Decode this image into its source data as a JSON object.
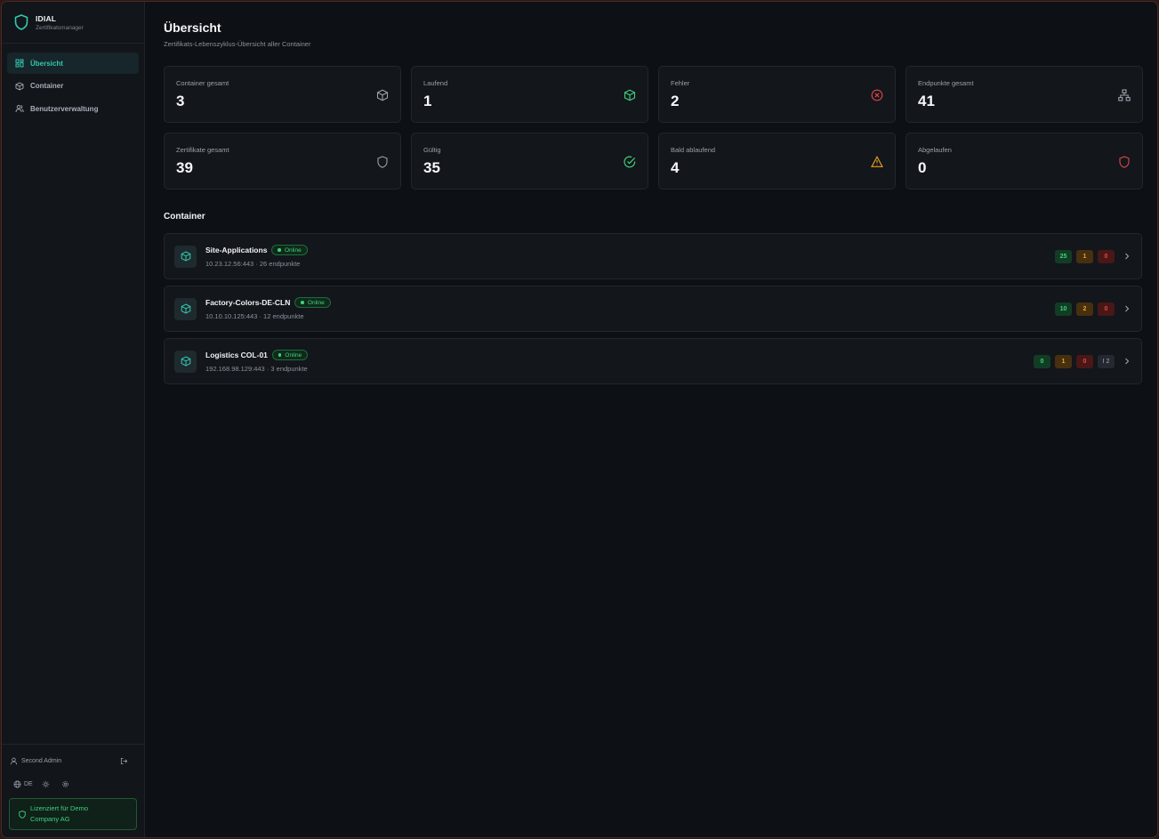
{
  "app": {
    "name": "IDIAL",
    "subtitle": "Zertifikatsmanager"
  },
  "sidebar": {
    "items": [
      {
        "label": "Übersicht",
        "icon": "grid-icon",
        "active": true
      },
      {
        "label": "Container",
        "icon": "box-icon",
        "active": false
      },
      {
        "label": "Benutzerverwaltung",
        "icon": "users-icon",
        "active": false
      }
    ],
    "user": "Second Admin",
    "language": "DE",
    "license": "Lizenziert für Demo Company AG"
  },
  "page": {
    "title": "Übersicht",
    "subtitle": "Zertifikats-Lebenszyklus-Übersicht aller Container"
  },
  "stats": [
    {
      "label": "Container gesamt",
      "value": "3",
      "icon": "box-icon",
      "color": "#9aa1ab"
    },
    {
      "label": "Laufend",
      "value": "1",
      "icon": "box-icon",
      "color": "#3fd17c"
    },
    {
      "label": "Fehler",
      "value": "2",
      "icon": "x-circle-icon",
      "color": "#e0484a"
    },
    {
      "label": "Endpunkte gesamt",
      "value": "41",
      "icon": "network-icon",
      "color": "#9aa1ab"
    },
    {
      "label": "Zertifikate gesamt",
      "value": "39",
      "icon": "shield-icon",
      "color": "#9aa1ab"
    },
    {
      "label": "Gültig",
      "value": "35",
      "icon": "check-circle-icon",
      "color": "#3fd17c"
    },
    {
      "label": "Bald ablaufend",
      "value": "4",
      "icon": "warning-icon",
      "color": "#f0a020"
    },
    {
      "label": "Abgelaufen",
      "value": "0",
      "icon": "shield-icon",
      "color": "#e0484a"
    }
  ],
  "containers_section": {
    "title": "Container"
  },
  "containers": [
    {
      "name": "Site-Applications",
      "status": "Online",
      "meta": "10.23.12.56:443 · 26 endpunkte",
      "counts": [
        "25",
        "1",
        "0"
      ],
      "extra": null
    },
    {
      "name": "Factory-Colors-DE-CLN",
      "status": "Online",
      "meta": "10.10.10.125:443 · 12 endpunkte",
      "counts": [
        "10",
        "2",
        "0"
      ],
      "extra": null
    },
    {
      "name": "Logistics COL-01",
      "status": "Online",
      "meta": "192.168.98.129:443 · 3 endpunkte",
      "counts": [
        "0",
        "1",
        "0"
      ],
      "extra": "I 2"
    }
  ],
  "colors": {
    "accent": "#33c7b0",
    "ok": "#3fd17c",
    "warn": "#f0a020",
    "error": "#e0484a"
  }
}
